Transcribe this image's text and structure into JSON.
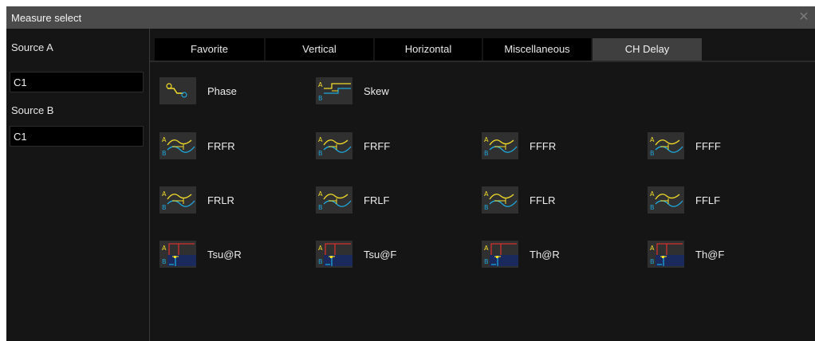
{
  "dialog": {
    "title": "Measure select",
    "close_icon": "close-icon"
  },
  "source_a": {
    "label": "Source A",
    "value": "C1"
  },
  "source_b": {
    "label": "Source B",
    "value": "C1"
  },
  "tabs": [
    {
      "label": "Favorite",
      "active": false
    },
    {
      "label": "Vertical",
      "active": false
    },
    {
      "label": "Horizontal",
      "active": false
    },
    {
      "label": "Miscellaneous",
      "active": false
    },
    {
      "label": "CH Delay",
      "active": true
    }
  ],
  "items": [
    {
      "label": "Phase",
      "icon": "phase-icon"
    },
    {
      "label": "Skew",
      "icon": "skew-icon"
    },
    {
      "label": "FRFR",
      "icon": "frfr-icon"
    },
    {
      "label": "FRFF",
      "icon": "frff-icon"
    },
    {
      "label": "FFFR",
      "icon": "fffr-icon"
    },
    {
      "label": "FFFF",
      "icon": "ffff-icon"
    },
    {
      "label": "FRLR",
      "icon": "frlr-icon"
    },
    {
      "label": "FRLF",
      "icon": "frlf-icon"
    },
    {
      "label": "FFLR",
      "icon": "fflr-icon"
    },
    {
      "label": "FFLF",
      "icon": "fflf-icon"
    },
    {
      "label": "Tsu@R",
      "icon": "setup-rise-icon"
    },
    {
      "label": "Tsu@F",
      "icon": "setup-fall-icon"
    },
    {
      "label": "Th@R",
      "icon": "hold-rise-icon"
    },
    {
      "label": "Th@F",
      "icon": "hold-fall-icon"
    }
  ],
  "icon_letters": {
    "a": "A",
    "b": "B"
  },
  "colors": {
    "channel_a": "#f2dc2a",
    "channel_b": "#1fa6d8",
    "marker": "#d03030"
  }
}
